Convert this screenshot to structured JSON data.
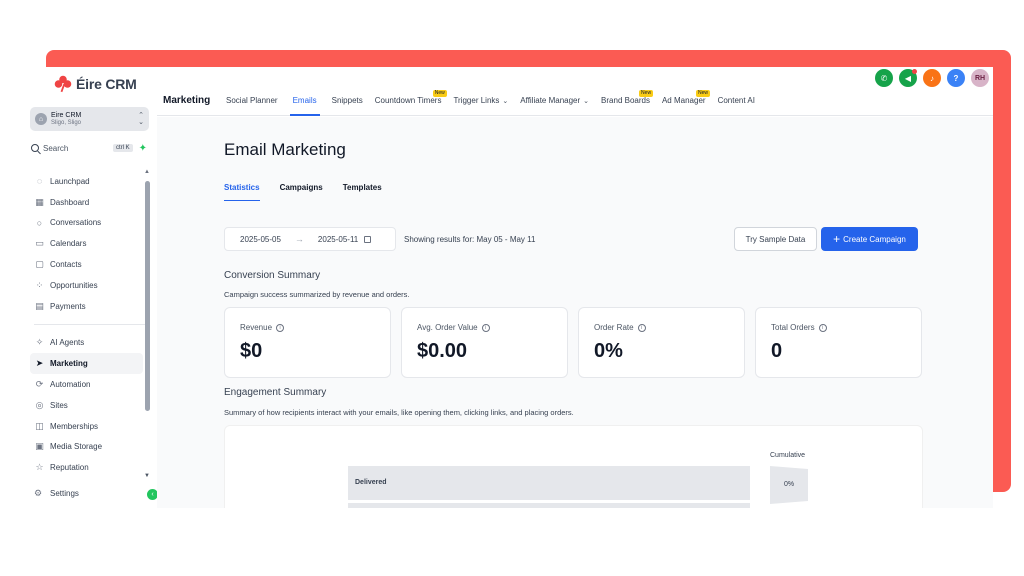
{
  "brand": {
    "name": "Éire CRM",
    "accent": "#fb5b53",
    "primary": "#2563eb"
  },
  "account": {
    "name": "Eire CRM",
    "location": "Sligo, Sligo"
  },
  "search": {
    "label": "Search",
    "shortcut": "ctrl K"
  },
  "sidebar": {
    "group1": [
      {
        "label": "Launchpad",
        "icon": "rocket-icon"
      },
      {
        "label": "Dashboard",
        "icon": "dashboard-icon"
      },
      {
        "label": "Conversations",
        "icon": "chat-icon"
      },
      {
        "label": "Calendars",
        "icon": "calendar-icon"
      },
      {
        "label": "Contacts",
        "icon": "contacts-icon"
      },
      {
        "label": "Opportunities",
        "icon": "opportunities-icon"
      },
      {
        "label": "Payments",
        "icon": "payments-icon"
      }
    ],
    "group2": [
      {
        "label": "AI Agents",
        "icon": "sparkle-icon"
      },
      {
        "label": "Marketing",
        "icon": "send-icon"
      },
      {
        "label": "Automation",
        "icon": "automation-icon"
      },
      {
        "label": "Sites",
        "icon": "globe-icon"
      },
      {
        "label": "Memberships",
        "icon": "memberships-icon"
      },
      {
        "label": "Media Storage",
        "icon": "image-icon"
      },
      {
        "label": "Reputation",
        "icon": "star-icon"
      }
    ],
    "settings": "Settings"
  },
  "topbar": {
    "title": "Marketing",
    "tabs": [
      {
        "label": "Social Planner"
      },
      {
        "label": "Emails"
      },
      {
        "label": "Snippets"
      },
      {
        "label": "Countdown Timers",
        "badge": "New"
      },
      {
        "label": "Trigger Links"
      },
      {
        "label": "Affiliate Manager"
      },
      {
        "label": "Brand Boards",
        "badge": "New"
      },
      {
        "label": "Ad Manager",
        "badge": "New"
      },
      {
        "label": "Content AI"
      }
    ],
    "avatar_initials": "RH"
  },
  "page": {
    "title": "Email Marketing",
    "subtabs": [
      "Statistics",
      "Campaigns",
      "Templates"
    ],
    "date_start": "2025-05-05",
    "date_end": "2025-05-11",
    "showing": "Showing results for: May 05 - May 11",
    "try_sample": "Try Sample Data",
    "create_campaign": "Create Campaign"
  },
  "conversion": {
    "title": "Conversion Summary",
    "desc": "Campaign success summarized by revenue and orders.",
    "cards": [
      {
        "label": "Revenue",
        "value": "$0"
      },
      {
        "label": "Avg. Order Value",
        "value": "$0.00"
      },
      {
        "label": "Order Rate",
        "value": "0%"
      },
      {
        "label": "Total Orders",
        "value": "0"
      }
    ]
  },
  "engagement": {
    "title": "Engagement Summary",
    "desc": "Summary of how recipients interact with your emails, like opening them, clicking links, and placing orders.",
    "funnel_label": "Delivered",
    "cumulative_title": "Cumulative",
    "cumulative_value": "0%"
  }
}
